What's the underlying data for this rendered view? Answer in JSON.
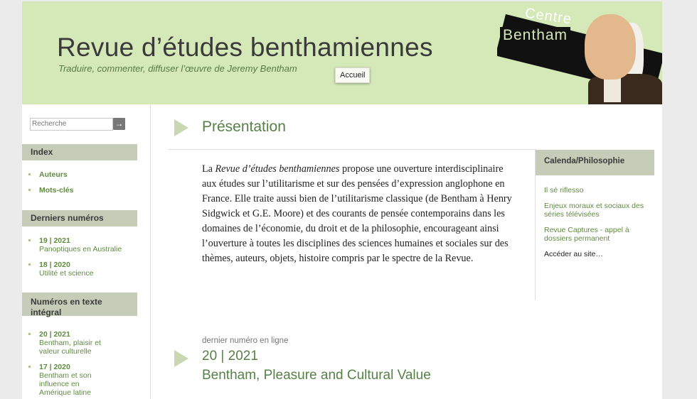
{
  "header": {
    "site_title": "Revue d’études benthamiennes",
    "subtitle": "Traduire, commenter, diffuser l’œuvre de Jeremy Bentham",
    "accueil_label": "Accueil",
    "logo_line1": "Centre",
    "logo_line2": "Bentham"
  },
  "search": {
    "placeholder": "Recherche",
    "button_icon": "→"
  },
  "sidebar": {
    "index": {
      "title": "Index",
      "items": [
        {
          "label": "Auteurs"
        },
        {
          "label": "Mots-clés"
        }
      ]
    },
    "derniers": {
      "title": "Derniers numéros",
      "items": [
        {
          "number": "19 | 2021",
          "title": "Panoptiques en Australie"
        },
        {
          "number": "18 | 2020",
          "title": "Utilité et science"
        }
      ]
    },
    "integral": {
      "title": "Numéros en texte intégral",
      "items": [
        {
          "number": "20 | 2021",
          "title": "Bentham, plaisir et valeur culturelle"
        },
        {
          "number": "17 | 2020",
          "title": "Bentham et son influence en Amérique latine"
        }
      ]
    }
  },
  "main": {
    "presentation_title": "Présentation",
    "presentation_text_em": "Revue d’études benthamiennes",
    "presentation_text_pre": "La ",
    "presentation_text_post": " propose une ouverture interdisciplinaire aux études sur l’utilitarisme et sur des pensées d’expression anglophone en France. Elle traite aussi bien de l’utilitarisme classique (de Bentham à Henry Sidgwick et G.E. Moore) et des courants de pensée contemporains dans les domaines de l’économie, du droit et de la philosophie, encourageant ainsi l’ouverture à toutes les disciplines des sciences humaines et sociales sur des thèmes, auteurs, objets, histoire compris par le spectre de la Revue.",
    "last_issue_label": "dernier numéro en ligne",
    "last_issue_number": "20 | 2021",
    "last_issue_title": "Bentham, Pleasure and Cultural Value"
  },
  "calenda": {
    "title": "Calenda/Philosophie",
    "items": [
      {
        "label": "Il sé riflesso"
      },
      {
        "label": "Enjeux moraux et sociaux des séries télévisées"
      },
      {
        "label": "Revue Captures - appel à dossiers permanent"
      }
    ],
    "more": "Accéder au site…"
  },
  "colors": {
    "header_bg": "#d4e8b8",
    "accent": "#578047",
    "block_bg": "#c5cdb8"
  }
}
